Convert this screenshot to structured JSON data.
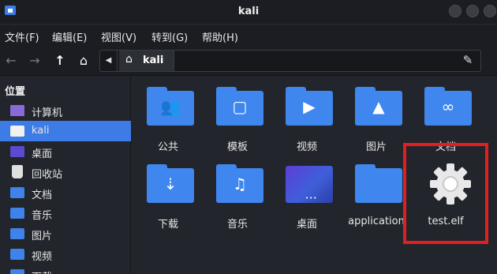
{
  "window": {
    "title": "kali"
  },
  "menu": [
    "文件(F)",
    "编辑(E)",
    "视图(V)",
    "转到(G)",
    "帮助(H)"
  ],
  "toolbar": {
    "back_icon": "arrow-left-icon",
    "forward_icon": "arrow-right-icon",
    "up_icon": "arrow-up-icon",
    "home_icon": "home-icon",
    "path_toggle_icon": "triangle-left-icon",
    "breadcrumb": "kali",
    "edit_icon": "pencil-icon"
  },
  "sidebar": {
    "title": "位置",
    "items": [
      {
        "label": "计算机",
        "icon": "computer-icon"
      },
      {
        "label": "kali",
        "icon": "home-folder-icon",
        "selected": true
      },
      {
        "label": "桌面",
        "icon": "desktop-icon"
      },
      {
        "label": "回收站",
        "icon": "trash-icon"
      },
      {
        "label": "文档",
        "icon": "documents-folder-icon"
      },
      {
        "label": "音乐",
        "icon": "music-folder-icon"
      },
      {
        "label": "图片",
        "icon": "pictures-folder-icon"
      },
      {
        "label": "视频",
        "icon": "videos-folder-icon"
      },
      {
        "label": "下载",
        "icon": "downloads-folder-icon"
      }
    ]
  },
  "files": [
    {
      "label": "公共",
      "icon": "public-folder-icon"
    },
    {
      "label": "模板",
      "icon": "templates-folder-icon"
    },
    {
      "label": "视频",
      "icon": "videos-folder-icon"
    },
    {
      "label": "图片",
      "icon": "pictures-folder-icon"
    },
    {
      "label": "文档",
      "icon": "documents-folder-icon"
    },
    {
      "label": "下载",
      "icon": "downloads-folder-icon"
    },
    {
      "label": "音乐",
      "icon": "music-folder-icon"
    },
    {
      "label": "桌面",
      "icon": "desktop-folder-icon"
    },
    {
      "label": "application",
      "icon": "folder-icon"
    },
    {
      "label": "test.elf",
      "icon": "gear-icon"
    }
  ],
  "colors": {
    "accent": "#3d7ce6",
    "folder": "#3f86ee",
    "highlight": "#e02020",
    "background": "#22252b"
  }
}
